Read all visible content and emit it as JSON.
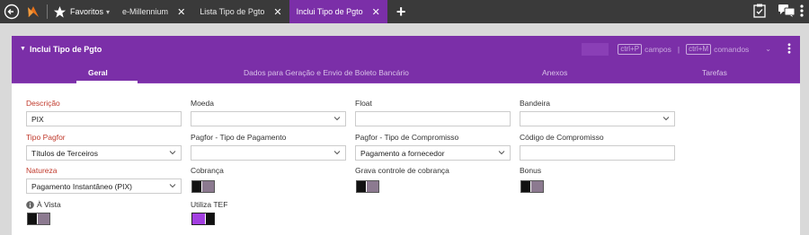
{
  "topbar": {
    "favorites_label": "Favoritos",
    "favorites_caret": "▾",
    "tabs": [
      {
        "label": "e-Millennium",
        "close": "✕"
      },
      {
        "label": "Lista Tipo de Pgto",
        "close": "✕"
      },
      {
        "label": "Inclui Tipo de Pgto",
        "close": "✕"
      }
    ],
    "new_tab": "+"
  },
  "panel": {
    "title": "Inclui Tipo de Pgto",
    "toggle_arrow": "▼",
    "shortcut_fields_key": "ctrl+P",
    "shortcut_fields_label": "campos",
    "pipe": "|",
    "shortcut_commands_key": "ctrl+M",
    "shortcut_commands_label": "comandos",
    "commands_caret": "⌄"
  },
  "tabs": [
    {
      "label": "Geral"
    },
    {
      "label": "Dados para Geração e Envio de Boleto Bancário"
    },
    {
      "label": "Anexos"
    },
    {
      "label": "Tarefas"
    }
  ],
  "form": {
    "descricao": {
      "label": "Descrição",
      "value": "PIX"
    },
    "moeda": {
      "label": "Moeda",
      "value": ""
    },
    "float": {
      "label": "Float",
      "value": ""
    },
    "bandeira": {
      "label": "Bandeira",
      "value": ""
    },
    "tipo_pagfor": {
      "label": "Tipo Pagfor",
      "value": "Títulos de Terceiros"
    },
    "pagfor_tipo_pagamento": {
      "label": "Pagfor - Tipo de Pagamento",
      "value": ""
    },
    "pagfor_tipo_compromisso": {
      "label": "Pagfor - Tipo de Compromisso",
      "value": "Pagamento a fornecedor"
    },
    "codigo_compromisso": {
      "label": "Código de Compromisso",
      "value": ""
    },
    "natureza": {
      "label": "Natureza",
      "value": "Pagamento Instantâneo (PIX)"
    },
    "cobranca": {
      "label": "Cobrança",
      "checked": false
    },
    "grava_controle": {
      "label": "Grava controle de cobrança",
      "checked": false
    },
    "bonus": {
      "label": "Bonus",
      "checked": false
    },
    "a_vista": {
      "label": "À Vista",
      "checked": false
    },
    "utiliza_tef": {
      "label": "Utiliza TEF",
      "checked": true
    }
  },
  "colors": {
    "accent": "#7b2fa8",
    "toggle_on": "#a23ee0",
    "required_label": "#c0392b",
    "topbar": "#3a3a3a"
  }
}
